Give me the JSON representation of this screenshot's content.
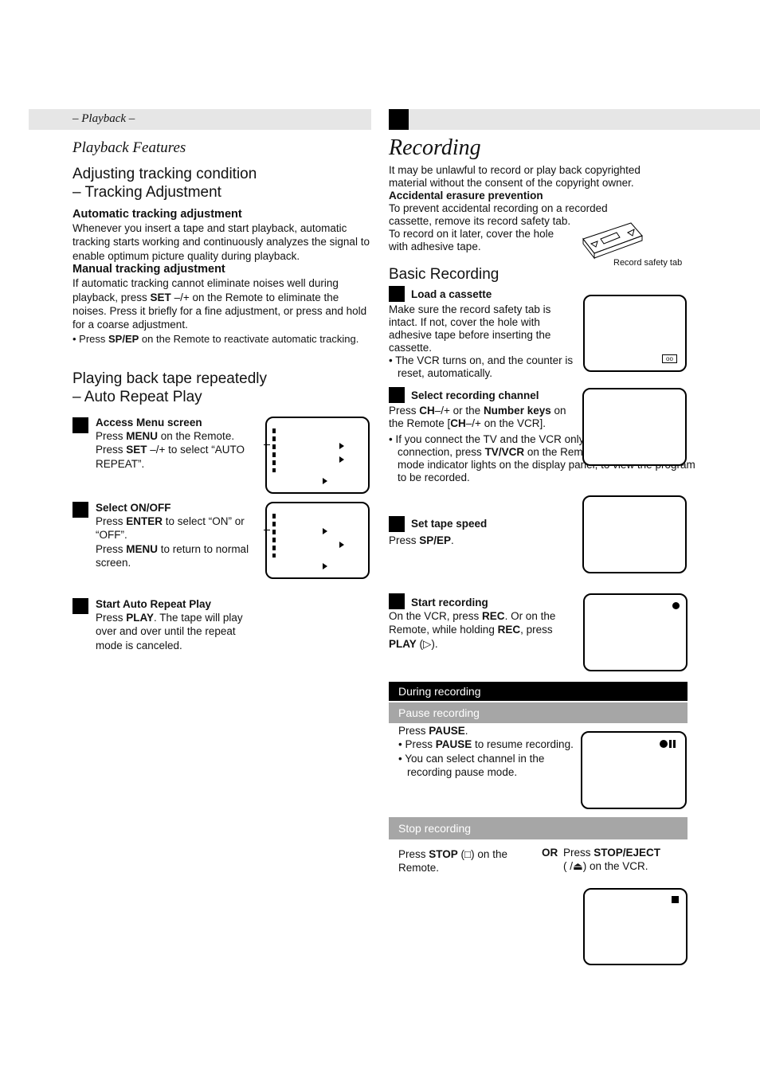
{
  "left": {
    "header_label": "– Playback –",
    "section_title": "Playback Features",
    "tracking": {
      "title_line1": "Adjusting tracking condition",
      "title_line2": "– Tracking Adjustment",
      "auto_heading": "Automatic tracking adjustment",
      "auto_body": "Whenever you insert a tape and start playback, automatic tracking starts working and continuously analyzes the signal to enable optimum picture quality during playback.",
      "manual_heading": "Manual tracking adjustment",
      "manual_body_pre": "If automatic tracking cannot eliminate noises well during playback, press ",
      "manual_body_key": "SET",
      "manual_body_post": " –/+ on the Remote to eliminate the noises. Press it briefly for a fine adjustment, or press and hold for a coarse adjustment.",
      "bullet_pre": "Press ",
      "bullet_key": "SP/EP",
      "bullet_post": " on the Remote to reactivate automatic tracking."
    },
    "repeat": {
      "title_line1": "Playing back tape repeatedly",
      "title_line2": "– Auto Repeat Play",
      "steps": [
        {
          "heading": "Access Menu screen",
          "line1_pre": "Press ",
          "line1_key": "MENU",
          "line1_post": " on the Remote.",
          "line2_pre": "Press ",
          "line2_key": "SET",
          "line2_post": " –/+ to select “AUTO REPEAT”."
        },
        {
          "heading": "Select ON/OFF",
          "line1_pre": "Press ",
          "line1_key": "ENTER",
          "line1_post": " to select “ON” or “OFF”.",
          "line2_pre": "Press ",
          "line2_key": "MENU",
          "line2_post": " to return to normal screen."
        },
        {
          "heading": "Start Auto Repeat Play",
          "line1_pre": "Press ",
          "line1_key": "PLAY",
          "line1_post": ". The tape will play over and over until the repeat mode is canceled."
        }
      ]
    }
  },
  "right": {
    "title": "Recording",
    "intro": "It may be unlawful to record or play back copyrighted material without the consent of the copyright owner.",
    "erasure_heading": "Accidental erasure prevention",
    "erasure_body1": "To prevent accidental recording on a recorded cassette, remove its record safety tab.",
    "erasure_body2": "To record on it later, cover the hole with adhesive tape.",
    "cassette_caption": "Record safety tab",
    "basic_title": "Basic Recording",
    "steps": [
      {
        "heading": "Load a cassette",
        "body": "Make sure the record safety tab is intact. If not, cover the hole with adhesive tape before inserting the cassette.",
        "bullet": "The VCR turns on, and the counter is reset, automatically.",
        "screen_icon": "cassette-icon"
      },
      {
        "heading": "Select recording channel",
        "body_pre": "Press ",
        "body_key1": "CH",
        "body_mid1": "–/+ or the ",
        "body_key2": "Number keys",
        "body_mid2": " on the Remote [",
        "body_key3": "CH",
        "body_post": "–/+ on the VCR].",
        "bullet_pre": "If you connect the TV and the VCR only using the RF connection, press ",
        "bullet_key": "TV/VCR",
        "bullet_post": " on the Remote so that the VCR mode indicator lights on the display panel, to view the program to be recorded."
      },
      {
        "heading": "Set tape speed",
        "body_pre": "Press ",
        "body_key": "SP/EP",
        "body_post": "."
      },
      {
        "heading": "Start recording",
        "body_pre": "On the VCR, press ",
        "body_key1": "REC",
        "body_mid": ". Or on the Remote, while holding ",
        "body_key2": "REC",
        "body_mid2": ", press ",
        "body_key3": "PLAY",
        "body_post": " (▷).",
        "screen_icon": "record-dot-icon"
      }
    ],
    "during": {
      "bar_label": "During recording",
      "pause": {
        "bar_label": "Pause recording",
        "body_pre": "Press ",
        "body_key": "PAUSE",
        "body_post": ".",
        "bullets": [
          {
            "pre": "Press ",
            "key": "PAUSE",
            "post": " to resume recording."
          },
          {
            "pre": "You can select channel in the recording pause mode.",
            "key": "",
            "post": ""
          }
        ],
        "screen_icon": "record-pause-icon"
      },
      "stop": {
        "bar_label": "Stop recording",
        "left_pre": "Press ",
        "left_key": "STOP",
        "left_post": " (□) on the Remote.",
        "or_label": "OR",
        "right_pre": "Press ",
        "right_key": "STOP/EJECT",
        "right_post": "( /⏏) on the VCR.",
        "screen_icon": "stop-square-icon"
      }
    }
  }
}
